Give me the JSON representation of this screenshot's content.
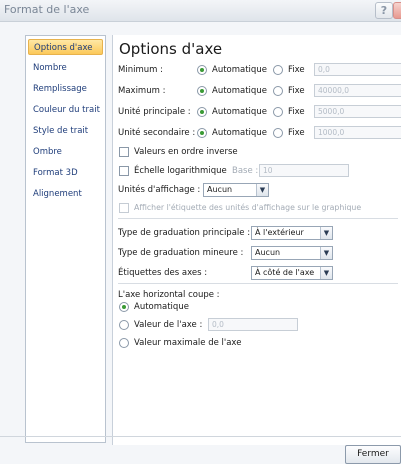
{
  "window": {
    "title": "Format de l'axe",
    "help_label": "?"
  },
  "sidebar": {
    "items": [
      {
        "label": "Options d'axe",
        "active": true
      },
      {
        "label": "Nombre"
      },
      {
        "label": "Remplissage"
      },
      {
        "label": "Couleur du trait"
      },
      {
        "label": "Style de trait"
      },
      {
        "label": "Ombre"
      },
      {
        "label": "Format 3D"
      },
      {
        "label": "Alignement"
      }
    ]
  },
  "main": {
    "heading": "Options d'axe",
    "rows": [
      {
        "label": "Minimum :",
        "auto": "Automatique",
        "fixed": "Fixe",
        "value": "0,0"
      },
      {
        "label": "Maximum :",
        "auto": "Automatique",
        "fixed": "Fixe",
        "value": "40000,0"
      },
      {
        "label": "Unité principale :",
        "auto": "Automatique",
        "fixed": "Fixe",
        "value": "5000,0"
      },
      {
        "label": "Unité secondaire :",
        "auto": "Automatique",
        "fixed": "Fixe",
        "value": "1000,0"
      }
    ],
    "reverse_order": "Valeurs en ordre inverse",
    "log_scale": "Échelle logarithmique",
    "base_label": "Base :",
    "base_value": "10",
    "display_units_label": "Unités d'affichage :",
    "display_units_value": "Aucun",
    "show_units_label": "Afficher l'étiquette des unités d'affichage sur le graphique",
    "major_tick_label": "Type de graduation principale :",
    "major_tick_value": "À l'extérieur",
    "minor_tick_label": "Type de graduation mineure :",
    "minor_tick_value": "Aucun",
    "axis_labels_label": "Étiquettes des axes :",
    "axis_labels_value": "À côté de l'axe",
    "crosses_label": "L'axe horizontal coupe :",
    "crosses_auto": "Automatique",
    "crosses_value_label": "Valeur de l'axe :",
    "crosses_value": "0,0",
    "crosses_max": "Valeur maximale de l'axe"
  },
  "footer": {
    "close_label": "Fermer"
  }
}
